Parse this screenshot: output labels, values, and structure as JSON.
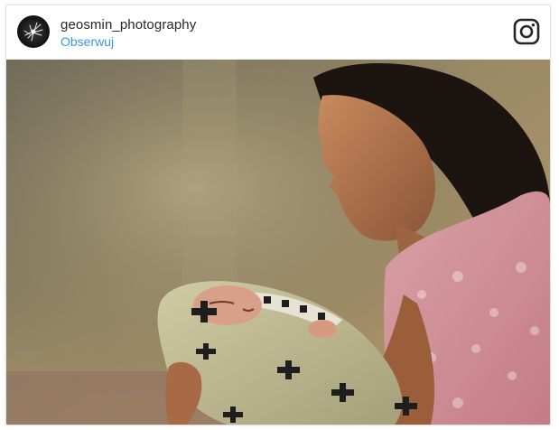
{
  "post": {
    "username": "geosmin_photography",
    "follow_label": "Obserwuj",
    "avatar_icon": "avatar-logo",
    "brand_icon": "instagram-icon",
    "photo_alt": "Woman smiling at a newborn baby wrapped in a blanket"
  },
  "colors": {
    "link": "#3897f0",
    "text": "#262626",
    "border": "#e3e3e3"
  }
}
